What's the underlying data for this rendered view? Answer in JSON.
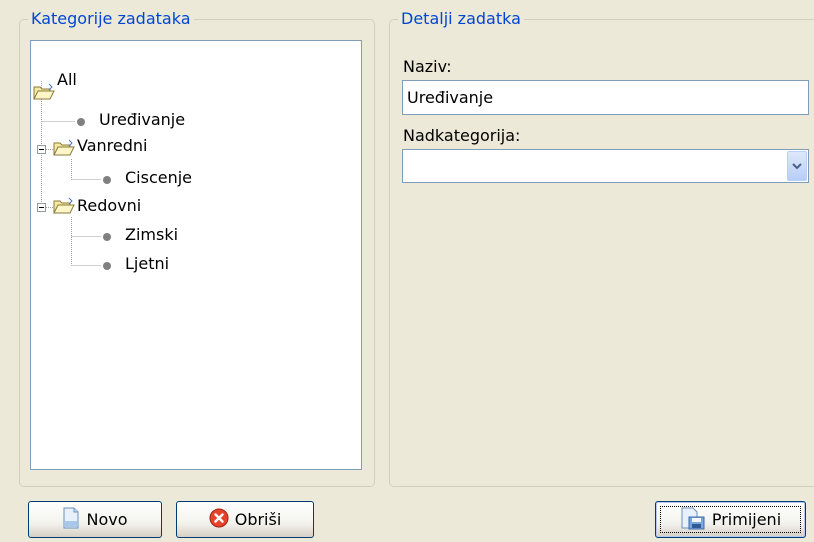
{
  "categories_group": {
    "title": "Kategorije zadataka",
    "tree": {
      "root": "All",
      "items": [
        {
          "label": "Uređivanje",
          "type": "leaf",
          "level": 1
        },
        {
          "label": "Vanredni",
          "type": "folder",
          "level": 1,
          "expanded": true
        },
        {
          "label": "Ciscenje",
          "type": "leaf",
          "level": 2
        },
        {
          "label": "Redovni",
          "type": "folder",
          "level": 1,
          "expanded": true
        },
        {
          "label": "Zimski",
          "type": "leaf",
          "level": 2
        },
        {
          "label": "Ljetni",
          "type": "leaf",
          "level": 2
        }
      ]
    }
  },
  "details_group": {
    "title": "Detalji zadatka",
    "name_label": "Naziv:",
    "name_value": "Uređivanje",
    "parent_label": "Nadkategorija:",
    "parent_value": ""
  },
  "buttons": {
    "new_label": "Novo",
    "delete_label": "Obriši",
    "apply_label": "Primijeni"
  },
  "colors": {
    "background": "#ece9d8",
    "groupbox_title": "#0046d5",
    "input_border": "#7f9db9",
    "button_border": "#003c74"
  },
  "icons": {
    "folder": "open-folder-icon",
    "leaf": "bullet-icon",
    "new": "document-icon",
    "delete": "red-x-icon",
    "apply": "save-apply-icon",
    "dropdown": "chevron-down-icon"
  }
}
